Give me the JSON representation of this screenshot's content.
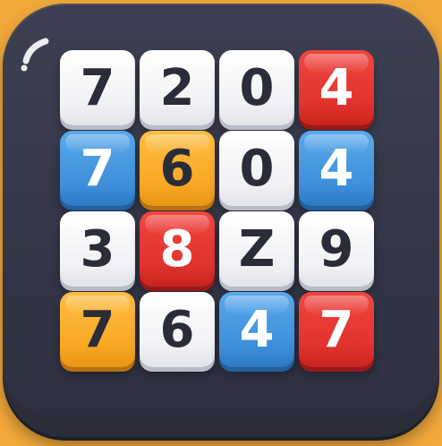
{
  "board": {
    "tiles": [
      {
        "value": "7",
        "color": "white"
      },
      {
        "value": "2",
        "color": "white"
      },
      {
        "value": "0",
        "color": "white"
      },
      {
        "value": "4",
        "color": "red"
      },
      {
        "value": "7",
        "color": "blue"
      },
      {
        "value": "6",
        "color": "orange"
      },
      {
        "value": "0",
        "color": "white"
      },
      {
        "value": "4",
        "color": "blue"
      },
      {
        "value": "3",
        "color": "white"
      },
      {
        "value": "8",
        "color": "red"
      },
      {
        "value": "Z",
        "color": "white"
      },
      {
        "value": "9",
        "color": "white"
      },
      {
        "value": "7",
        "color": "orange"
      },
      {
        "value": "6",
        "color": "white"
      },
      {
        "value": "4",
        "color": "blue"
      },
      {
        "value": "7",
        "color": "red"
      }
    ]
  },
  "colors": {
    "background": "#f2a93b",
    "icon_body": "#343747",
    "tile_white": "#f1f2f5",
    "tile_red": "#e2332f",
    "tile_blue": "#3f90dc",
    "tile_orange": "#f8a823",
    "digit_dark": "#2a2c38"
  }
}
